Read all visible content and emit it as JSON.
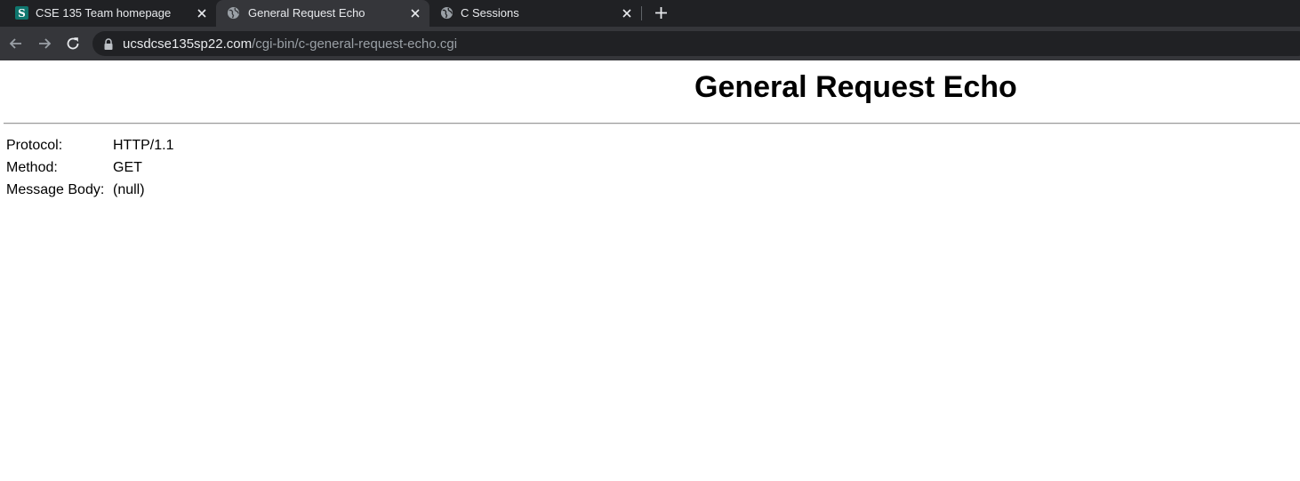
{
  "browser": {
    "tabs": [
      {
        "title": "CSE 135 Team homepage",
        "favicon": "s-logo-icon",
        "active": false
      },
      {
        "title": "General Request Echo",
        "favicon": "globe-icon",
        "active": true
      },
      {
        "title": "C Sessions",
        "favicon": "globe-icon",
        "active": false
      }
    ],
    "url_host": "ucsdcse135sp22.com",
    "url_path": "/cgi-bin/c-general-request-echo.cgi",
    "colors": {
      "tabstrip_bg": "#202124",
      "active_tab_bg": "#35363a",
      "omnibox_bg": "#202124",
      "text": "#e8eaed",
      "url_path": "#9aa0a6",
      "favicon_accent": "#0f766e"
    }
  },
  "page": {
    "heading": "General Request Echo",
    "fields": [
      {
        "label": "Protocol:",
        "value": "HTTP/1.1"
      },
      {
        "label": "Method:",
        "value": "GET"
      },
      {
        "label": "Message Body:",
        "value": "(null)"
      }
    ]
  }
}
